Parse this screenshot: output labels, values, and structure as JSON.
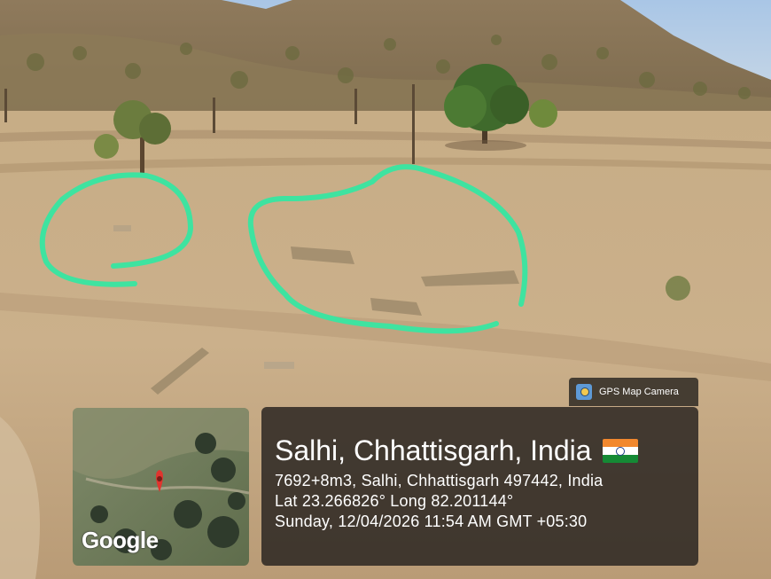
{
  "app": {
    "name": "GPS Map Camera",
    "icon": "gps-map-camera-icon"
  },
  "map": {
    "brand": "Google",
    "marker_icon": "location-pin-icon",
    "marker_color": "#e0342e"
  },
  "location": {
    "title": "Salhi, Chhattisgarh, India",
    "flag_icon": "india-flag-icon",
    "address": "7692+8m3, Salhi, Chhattisgarh 497442, India",
    "coordinates": "Lat 23.266826° Long 82.201144°",
    "datetime": "Sunday, 12/04/2026 11:54 AM GMT +05:30"
  },
  "annotation": {
    "color": "#3ee3a0",
    "shape": "hand-drawn outline",
    "count": 2
  },
  "flag_colors": {
    "saffron": "#f2882e",
    "white": "#ffffff",
    "green": "#158a35",
    "wheel": "#22408b"
  }
}
